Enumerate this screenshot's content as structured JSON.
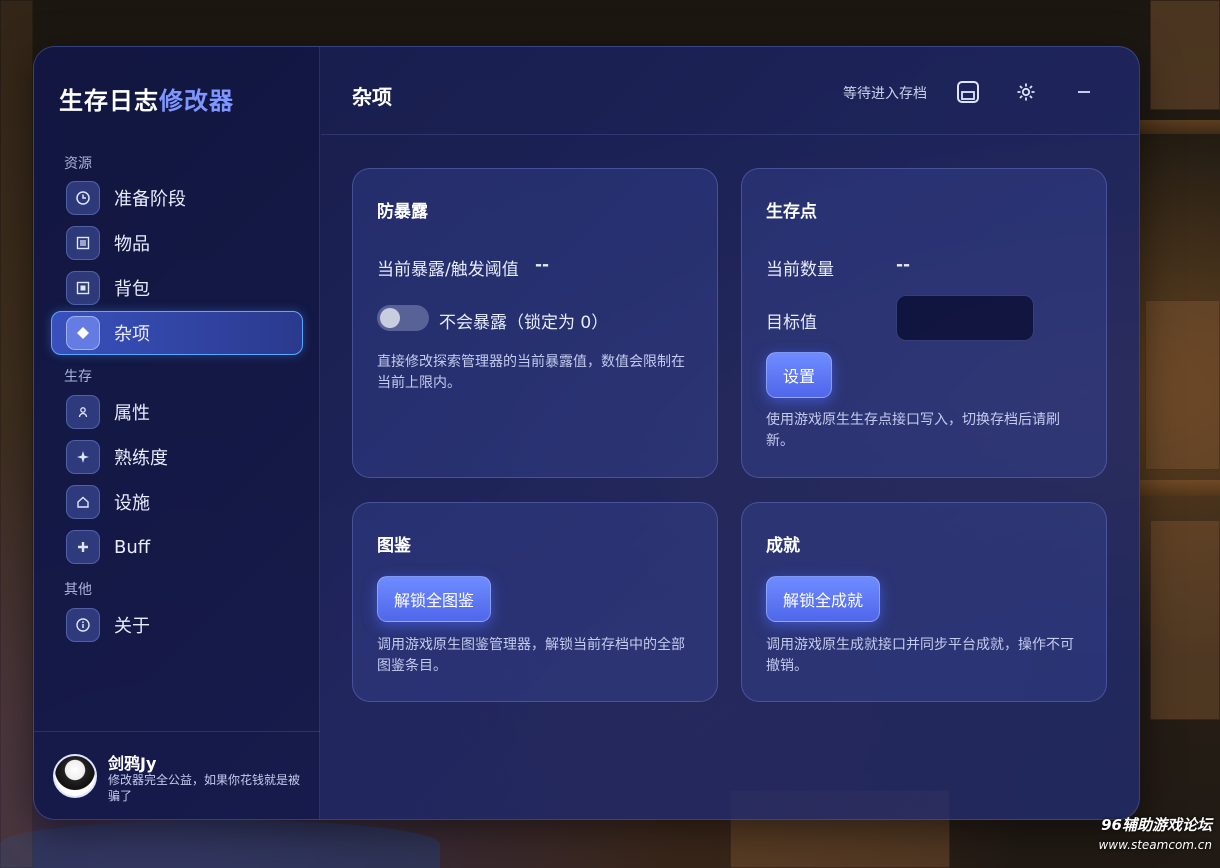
{
  "app": {
    "title_main": "生存日志",
    "title_accent": "修改器"
  },
  "sidebar": {
    "sections": [
      {
        "label": "资源"
      },
      {
        "label": "生存"
      },
      {
        "label": "其他"
      }
    ],
    "items": [
      {
        "label": "准备阶段",
        "icon": "clock-icon"
      },
      {
        "label": "物品",
        "icon": "list-icon"
      },
      {
        "label": "背包",
        "icon": "backpack-icon"
      },
      {
        "label": "杂项",
        "icon": "diamond-icon",
        "active": true
      },
      {
        "label": "属性",
        "icon": "person-icon"
      },
      {
        "label": "熟练度",
        "icon": "sparkle-icon"
      },
      {
        "label": "设施",
        "icon": "home-icon"
      },
      {
        "label": "Buff",
        "icon": "plus-icon"
      },
      {
        "label": "关于",
        "icon": "info-icon"
      }
    ]
  },
  "profile": {
    "name": "剑鸦Jy",
    "description": "修改器完全公益，如果你花钱就是被骗了"
  },
  "topbar": {
    "title": "杂项",
    "status": "等待进入存档"
  },
  "cards": {
    "exposure": {
      "title": "防暴露",
      "current_label": "当前暴露/触发阈值",
      "current_value": "--",
      "toggle_label": "不会暴露（锁定为 0）",
      "toggle_on": false,
      "description": "直接修改探索管理器的当前暴露值，数值会限制在当前上限内。"
    },
    "spawn": {
      "title": "生存点",
      "current_label": "当前数量",
      "current_value": "--",
      "target_label": "目标值",
      "target_value": "",
      "button": "设置",
      "description": "使用游戏原生生存点接口写入，切换存档后请刷新。"
    },
    "codex": {
      "title": "图鉴",
      "button": "解锁全图鉴",
      "description": "调用游戏原生图鉴管理器，解锁当前存档中的全部图鉴条目。"
    },
    "achievements": {
      "title": "成就",
      "button": "解锁全成就",
      "description": "调用游戏原生成就接口并同步平台成就，操作不可撤销。"
    }
  },
  "watermark": {
    "line1": "96辅助游戏论坛",
    "line2": "www.steamcom.cn"
  }
}
